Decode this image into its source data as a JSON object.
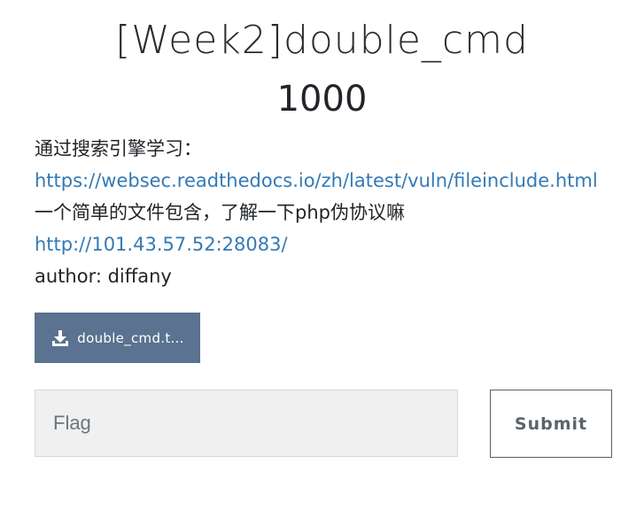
{
  "challenge": {
    "title": "[Week2]double_cmd",
    "points": "1000",
    "description": {
      "intro_text": "通过搜索引擎学习：",
      "reference_link": "https://websec.readthedocs.io/zh/latest/vuln/fileinclude.html",
      "hint": "一个简单的文件包含，了解一下php伪协议嘛",
      "target_link": "http://101.43.57.52:28083/",
      "author": "author: diffany"
    },
    "attachment": {
      "label": "double_cmd.t...",
      "icon": "download-icon"
    },
    "flag_form": {
      "placeholder": "Flag",
      "value": "",
      "submit_label": "Submit"
    }
  },
  "colors": {
    "link": "#337ab7",
    "attachment_button": "#5b7290",
    "input_background": "#f0f0f0"
  }
}
